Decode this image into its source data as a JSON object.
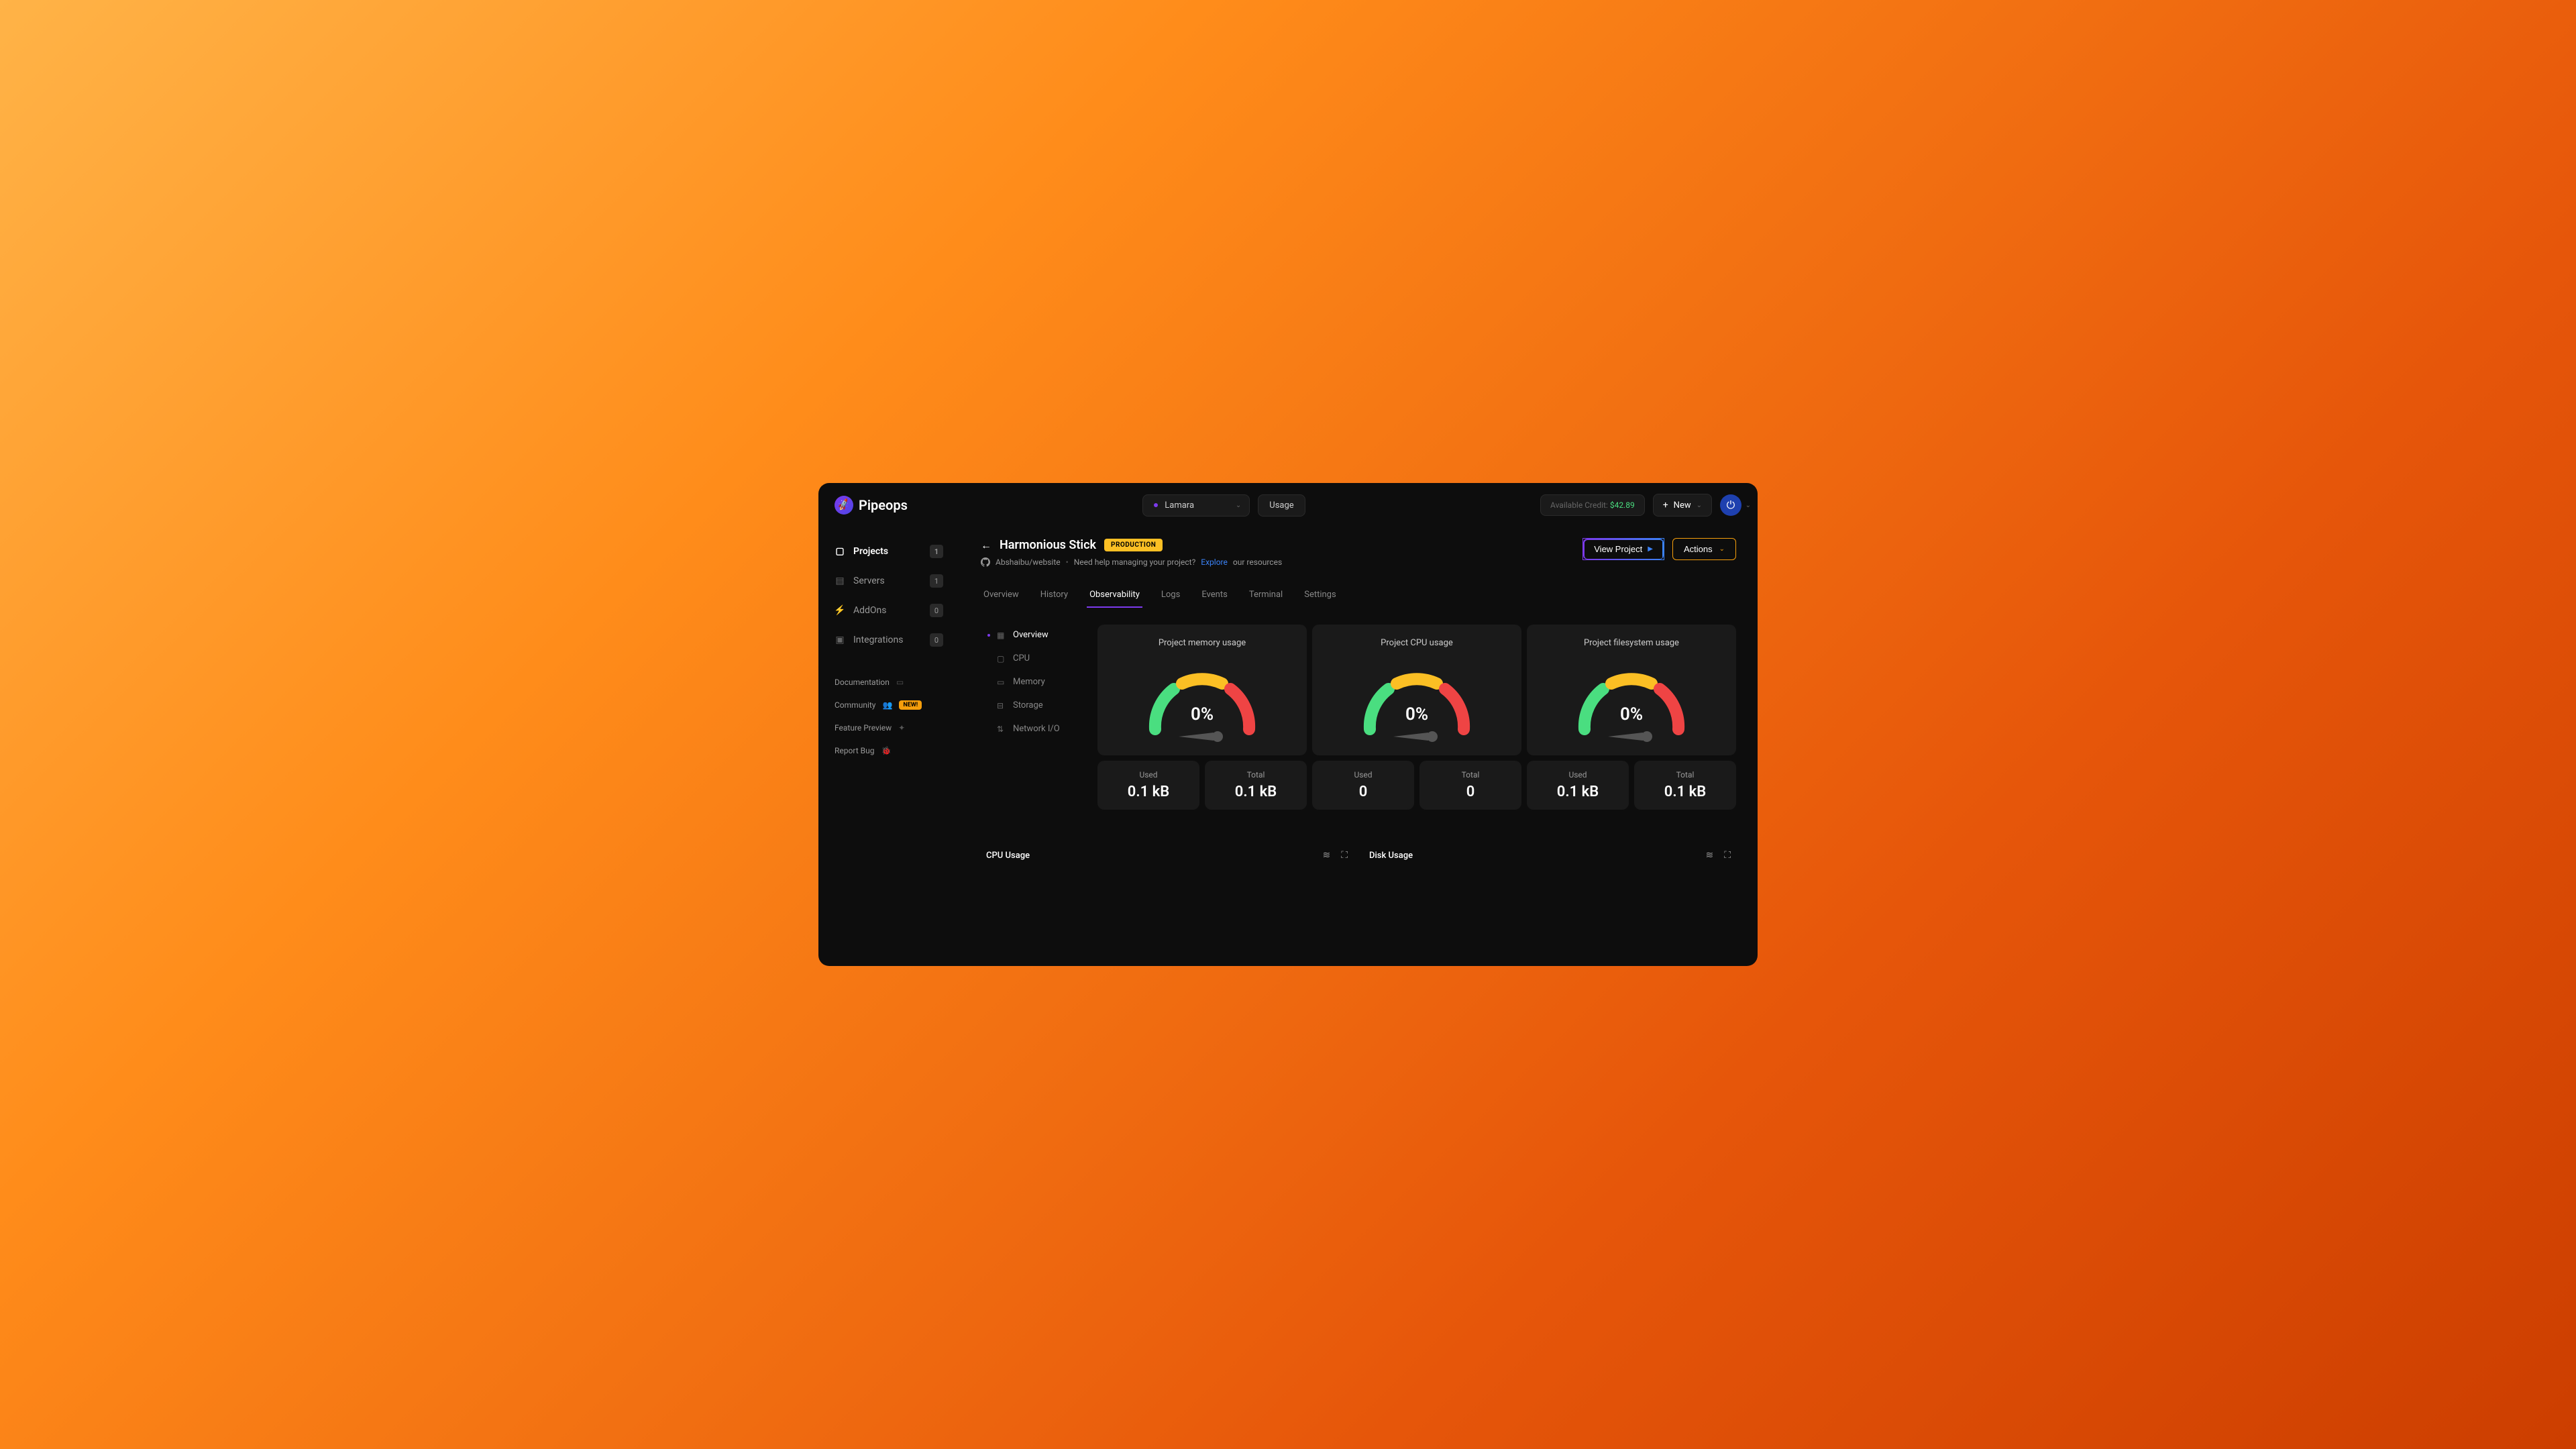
{
  "brand": "Pipeops",
  "header": {
    "workspace": "Lamara",
    "usage_label": "Usage",
    "credit_label": "Available Credit: ",
    "credit_amount": "$42.89",
    "new_label": "New"
  },
  "sidebar": {
    "items": [
      {
        "label": "Projects",
        "badge": "1",
        "active": true
      },
      {
        "label": "Servers",
        "badge": "1",
        "active": false
      },
      {
        "label": "AddOns",
        "badge": "0",
        "active": false
      },
      {
        "label": "Integrations",
        "badge": "0",
        "active": false
      }
    ],
    "links": [
      {
        "label": "Documentation",
        "tag": ""
      },
      {
        "label": "Community",
        "tag": "NEW!"
      },
      {
        "label": "Feature Preview",
        "tag": ""
      },
      {
        "label": "Report Bug",
        "tag": ""
      }
    ]
  },
  "page": {
    "title": "Harmonious Stick",
    "env": "PRODUCTION",
    "repo": "Abshaibu/website",
    "help_prefix": "Need help managing your project? ",
    "explore": "Explore",
    "help_suffix": " our resources",
    "view_project": "View Project",
    "actions": "Actions"
  },
  "tabs": [
    "Overview",
    "History",
    "Observability",
    "Logs",
    "Events",
    "Terminal",
    "Settings"
  ],
  "active_tab": "Observability",
  "subnav": [
    "Overview",
    "CPU",
    "Memory",
    "Storage",
    "Network I/O"
  ],
  "active_subnav": "Overview",
  "gauges": [
    {
      "title": "Project memory usage",
      "percent": "0%",
      "used_label": "Used",
      "used": "0.1 kB",
      "total_label": "Total",
      "total": "0.1 kB"
    },
    {
      "title": "Project CPU usage",
      "percent": "0%",
      "used_label": "Used",
      "used": "0",
      "total_label": "Total",
      "total": "0"
    },
    {
      "title": "Project filesystem usage",
      "percent": "0%",
      "used_label": "Used",
      "used": "0.1 kB",
      "total_label": "Total",
      "total": "0.1 kB"
    }
  ],
  "chart_data": [
    {
      "type": "gauge",
      "title": "Project memory usage",
      "value": 0,
      "min": 0,
      "max": 100,
      "unit": "%",
      "used": "0.1 kB",
      "total": "0.1 kB",
      "segments": [
        {
          "color": "#4ade80",
          "range": [
            0,
            33
          ]
        },
        {
          "color": "#fbbf24",
          "range": [
            33,
            66
          ]
        },
        {
          "color": "#ef4444",
          "range": [
            66,
            100
          ]
        }
      ]
    },
    {
      "type": "gauge",
      "title": "Project CPU usage",
      "value": 0,
      "min": 0,
      "max": 100,
      "unit": "%",
      "used": "0",
      "total": "0",
      "segments": [
        {
          "color": "#4ade80",
          "range": [
            0,
            33
          ]
        },
        {
          "color": "#fbbf24",
          "range": [
            33,
            66
          ]
        },
        {
          "color": "#ef4444",
          "range": [
            66,
            100
          ]
        }
      ]
    },
    {
      "type": "gauge",
      "title": "Project filesystem usage",
      "value": 0,
      "min": 0,
      "max": 100,
      "unit": "%",
      "used": "0.1 kB",
      "total": "0.1 kB",
      "segments": [
        {
          "color": "#4ade80",
          "range": [
            0,
            33
          ]
        },
        {
          "color": "#fbbf24",
          "range": [
            33,
            66
          ]
        },
        {
          "color": "#ef4444",
          "range": [
            66,
            100
          ]
        }
      ]
    }
  ],
  "usage_panels": [
    "CPU Usage",
    "Disk Usage"
  ]
}
